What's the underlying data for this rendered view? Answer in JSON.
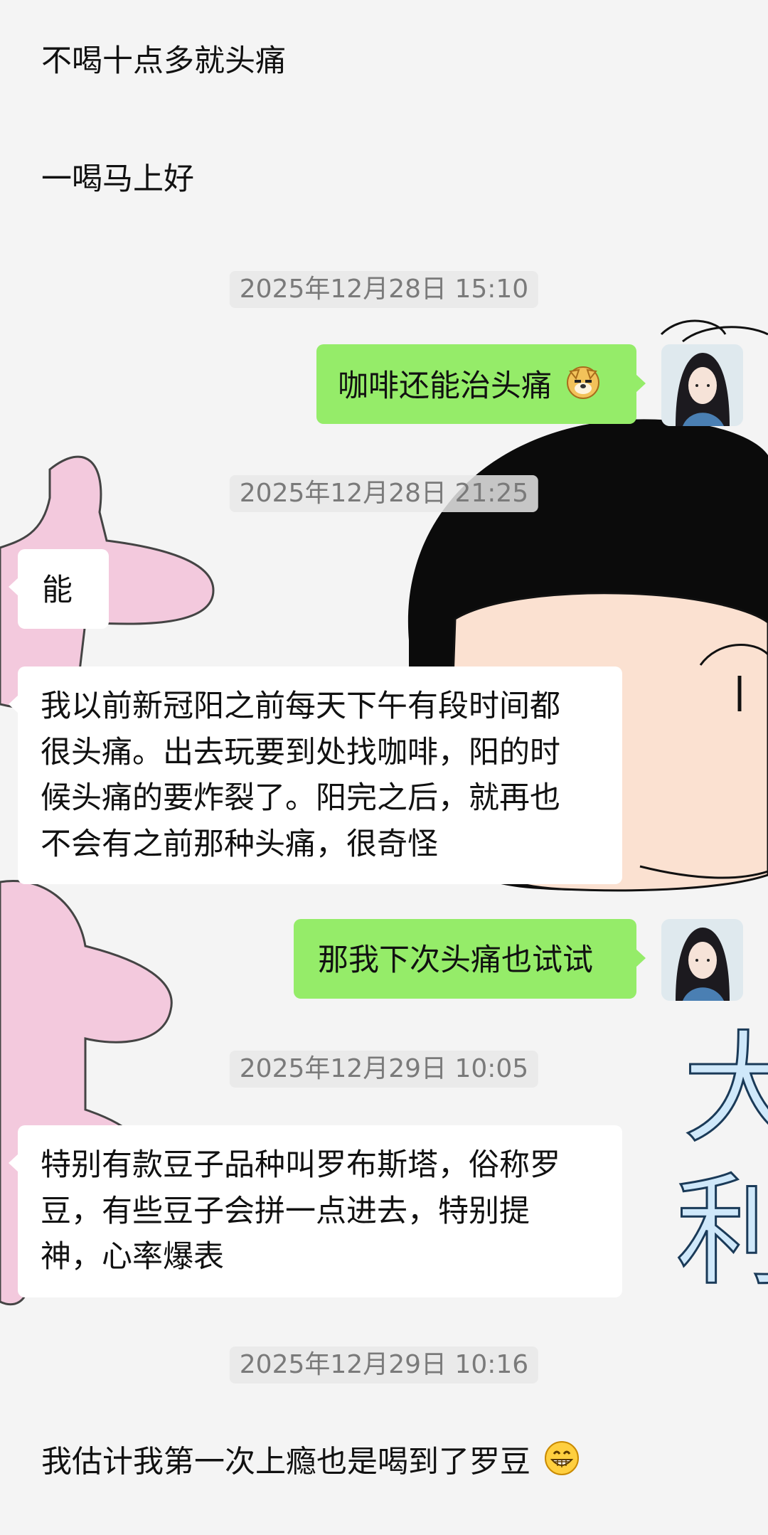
{
  "messages": [
    {
      "id": "m1",
      "side": "left-plain",
      "text": "不喝十点多就头痛"
    },
    {
      "id": "m2",
      "side": "left-plain",
      "text": "一喝马上好"
    },
    {
      "id": "t1",
      "type": "timestamp",
      "text": "2025年12月28日 15:10"
    },
    {
      "id": "m3",
      "side": "right",
      "text": "咖啡还能治头痛",
      "emoji": "doge-emoji"
    },
    {
      "id": "t2",
      "type": "timestamp",
      "text": "2025年12月28日 21:25"
    },
    {
      "id": "m4",
      "side": "left",
      "text": "能"
    },
    {
      "id": "m5",
      "side": "left",
      "lines": [
        "我以前新冠阳之前每天下午有段时间都",
        "很头痛。出去玩要到处找咖啡，阳的时",
        "候头痛的要炸裂了。阳完之后，就再也",
        "不会有之前那种头痛，很奇怪"
      ]
    },
    {
      "id": "m6",
      "side": "right",
      "text": "那我下次头痛也试试"
    },
    {
      "id": "t3",
      "type": "timestamp",
      "text": "2025年12月29日 10:05"
    },
    {
      "id": "m7",
      "side": "left",
      "lines": [
        "特别有款豆子品种叫罗布斯塔，俗称罗",
        "豆，有些豆子会拼一点进去，特别提",
        "神，心率爆表"
      ]
    },
    {
      "id": "t4",
      "type": "timestamp",
      "text": "2025年12月29日 10:16"
    },
    {
      "id": "m8",
      "side": "left-plain",
      "text": "我估计我第一次上瘾也是喝到了罗豆",
      "emoji": "grin-emoji"
    }
  ],
  "background": {
    "theme": "cartoon-face-wallpaper",
    "chars": [
      "大",
      "利"
    ]
  },
  "colors": {
    "self_bubble": "#95ec69",
    "other_bubble": "#ffffff",
    "timestamp_text": "#7a7a7a",
    "chat_bg": "#f4f4f4"
  }
}
